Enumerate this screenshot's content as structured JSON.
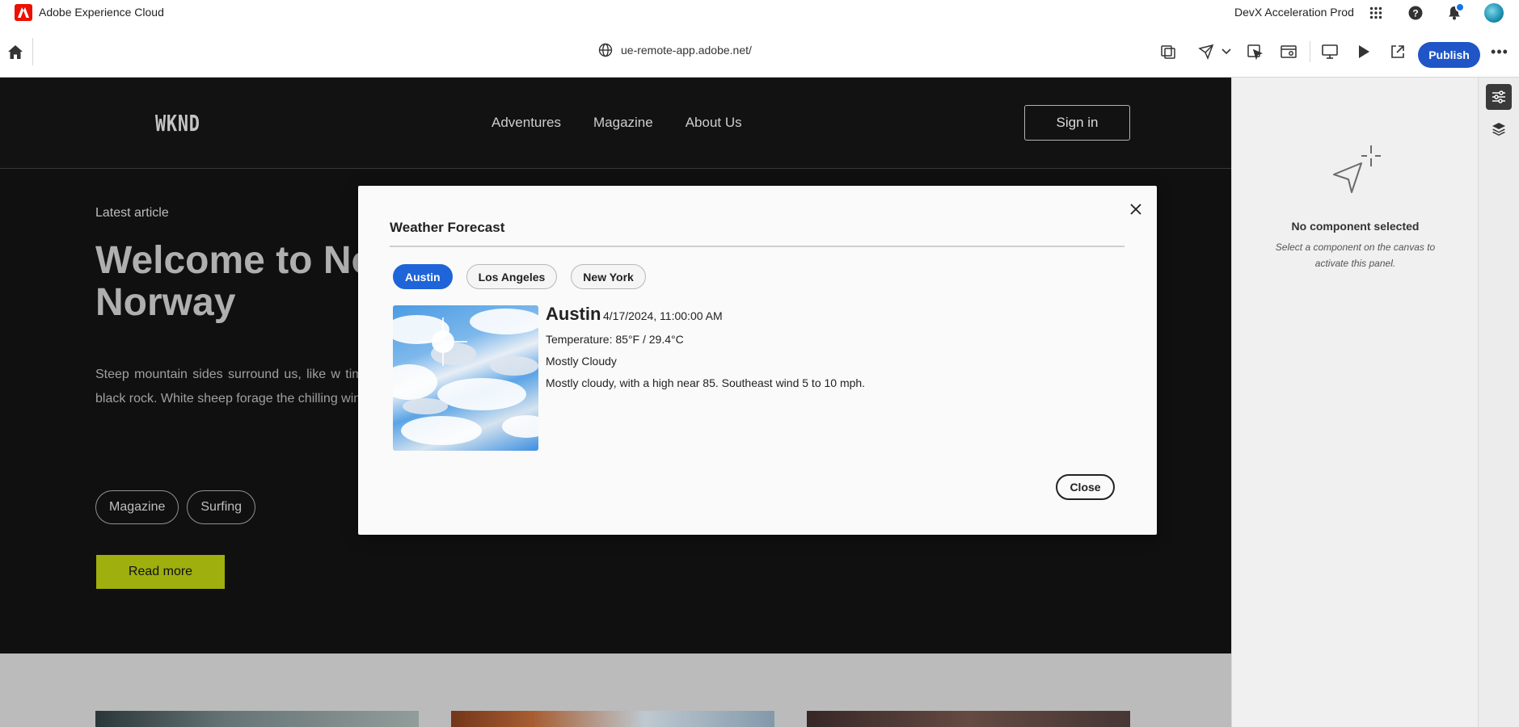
{
  "appbar": {
    "title": "Adobe Experience Cloud",
    "org": "DevX Acceleration Prod",
    "icons": [
      "adobe-logo-icon",
      "apps-grid-icon",
      "help-icon",
      "bell-icon",
      "avatar"
    ]
  },
  "toolbar": {
    "url": "ue-remote-app.adobe.net/",
    "publish_label": "Publish",
    "more_label": "•••",
    "publish_color": "#1f55c6"
  },
  "site": {
    "logo": "WKND",
    "nav": [
      "Adventures",
      "Magazine",
      "About Us"
    ],
    "signin_label": "Sign in",
    "latest_label": "Latest article",
    "hero_title": "Welcome to Nor\nNorway",
    "hero_text": "Steep mountain sides surround us, like w timeline, weathered and worn by long-gone covering the black rock. White sheep forage the chilling winds funneled by the deep valley",
    "tags": [
      "Magazine",
      "Surfing"
    ],
    "readmore_label": "Read more",
    "accent": "#a7b90f"
  },
  "modal": {
    "title": "Weather Forecast",
    "tabs": [
      {
        "label": "Austin",
        "active": true
      },
      {
        "label": "Los Angeles",
        "active": false
      },
      {
        "label": "New York",
        "active": false
      }
    ],
    "city": "Austin",
    "datetime": "4/17/2024, 11:00:00 AM",
    "temperature": "Temperature: 85°F / 29.4°C",
    "condition": "Mostly Cloudy",
    "detail": "Mostly cloudy, with a high near 85. Southeast wind 5 to 10 mph.",
    "close_label": "Close",
    "tab_active_color": "#1f64d8"
  },
  "panel": {
    "title": "No component selected",
    "subtitle": "Select a component on the canvas to activate this panel."
  }
}
